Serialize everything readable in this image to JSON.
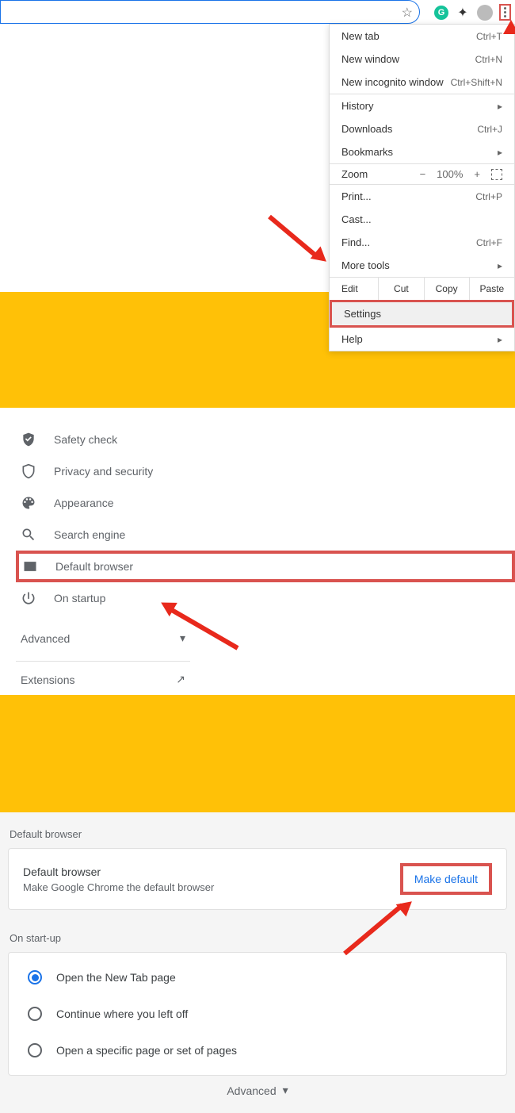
{
  "toolbar": {
    "grammarly_badge": "G"
  },
  "menu": {
    "new_tab": "New tab",
    "new_tab_sc": "Ctrl+T",
    "new_window": "New window",
    "new_window_sc": "Ctrl+N",
    "incognito": "New incognito window",
    "incognito_sc": "Ctrl+Shift+N",
    "history": "History",
    "downloads": "Downloads",
    "downloads_sc": "Ctrl+J",
    "bookmarks": "Bookmarks",
    "zoom_label": "Zoom",
    "zoom_value": "100%",
    "print": "Print...",
    "print_sc": "Ctrl+P",
    "cast": "Cast...",
    "find": "Find...",
    "find_sc": "Ctrl+F",
    "more_tools": "More tools",
    "edit": "Edit",
    "cut": "Cut",
    "copy": "Copy",
    "paste": "Paste",
    "settings": "Settings",
    "help": "Help"
  },
  "sidebar": {
    "safety": "Safety check",
    "privacy": "Privacy and security",
    "appearance": "Appearance",
    "search": "Search engine",
    "default_browser": "Default browser",
    "startup": "On startup",
    "advanced": "Advanced",
    "extensions": "Extensions"
  },
  "settings_page": {
    "default_heading": "Default browser",
    "default_title": "Default browser",
    "default_sub": "Make Google Chrome the default browser",
    "make_default": "Make default",
    "startup_heading": "On start-up",
    "opt_newtab": "Open the New Tab page",
    "opt_continue": "Continue where you left off",
    "opt_specific": "Open a specific page or set of pages",
    "advanced": "Advanced"
  }
}
